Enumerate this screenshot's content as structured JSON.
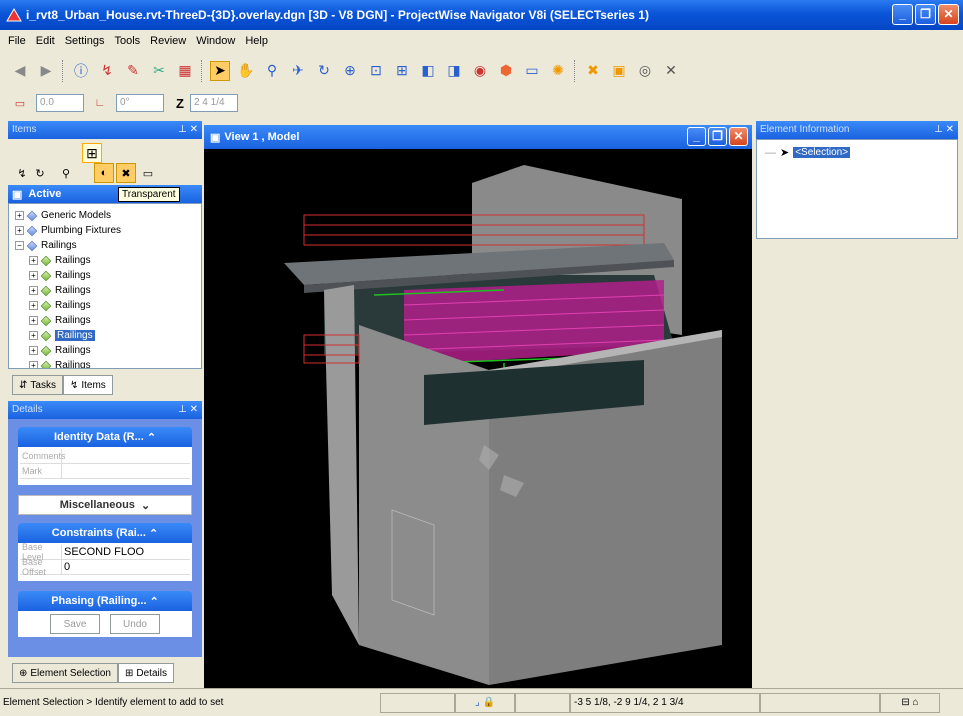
{
  "window": {
    "title": "i_rvt8_Urban_House.rvt-ThreeD-{3D}.overlay.dgn [3D - V8 DGN] - ProjectWise Navigator V8i (SELECTseries 1)"
  },
  "menu": [
    "File",
    "Edit",
    "Settings",
    "Tools",
    "Review",
    "Window",
    "Help"
  ],
  "toolbar2": {
    "x_value": "0.0",
    "angle_value": "0°",
    "z_label": "Z",
    "z_value": "2 4 1/4"
  },
  "items_panel": {
    "title": "Items",
    "active_label": "Active",
    "tooltip": "Transparent",
    "tree": [
      {
        "label": "Generic Models",
        "level": 0,
        "expander": "+"
      },
      {
        "label": "Plumbing Fixtures",
        "level": 0,
        "expander": "+"
      },
      {
        "label": "Railings",
        "level": 0,
        "expander": "−"
      },
      {
        "label": "Railings",
        "level": 1,
        "expander": "+"
      },
      {
        "label": "Railings",
        "level": 1,
        "expander": "+"
      },
      {
        "label": "Railings",
        "level": 1,
        "expander": "+"
      },
      {
        "label": "Railings",
        "level": 1,
        "expander": "+"
      },
      {
        "label": "Railings",
        "level": 1,
        "expander": "+"
      },
      {
        "label": "Railings",
        "level": 1,
        "expander": "+",
        "selected": true
      },
      {
        "label": "Railings",
        "level": 1,
        "expander": "+"
      },
      {
        "label": "Railings",
        "level": 1,
        "expander": "+"
      }
    ],
    "tabs": {
      "tasks": "Tasks",
      "items": "Items"
    }
  },
  "details_panel": {
    "title": "Details",
    "identity": {
      "header": "Identity Data (R...",
      "comments_key": "Comments",
      "mark_key": "Mark"
    },
    "misc_header": "Miscellaneous",
    "constraints": {
      "header": "Constraints (Rai...",
      "base_level_key": "Base Level",
      "base_level_value": "SECOND FLOO",
      "base_offset_key": "Base Offset",
      "base_offset_value": "0"
    },
    "phasing_header": "Phasing (Railing...",
    "save_label": "Save",
    "undo_label": "Undo",
    "tabs": {
      "element_selection": "Element Selection",
      "details": "Details"
    }
  },
  "view": {
    "title": "View 1 , Model"
  },
  "element_info": {
    "title": "Element Information",
    "selection": "<Selection>"
  },
  "status": {
    "message": "Element Selection > Identify element to add to set",
    "coords": "-3 5 1/8, -2 9 1/4, 2 1 3/4"
  },
  "colors": {
    "titlebar": "#0a55d8",
    "selection": "#316ac5",
    "railing": "#e0208a",
    "red_railing": "#d03030"
  }
}
